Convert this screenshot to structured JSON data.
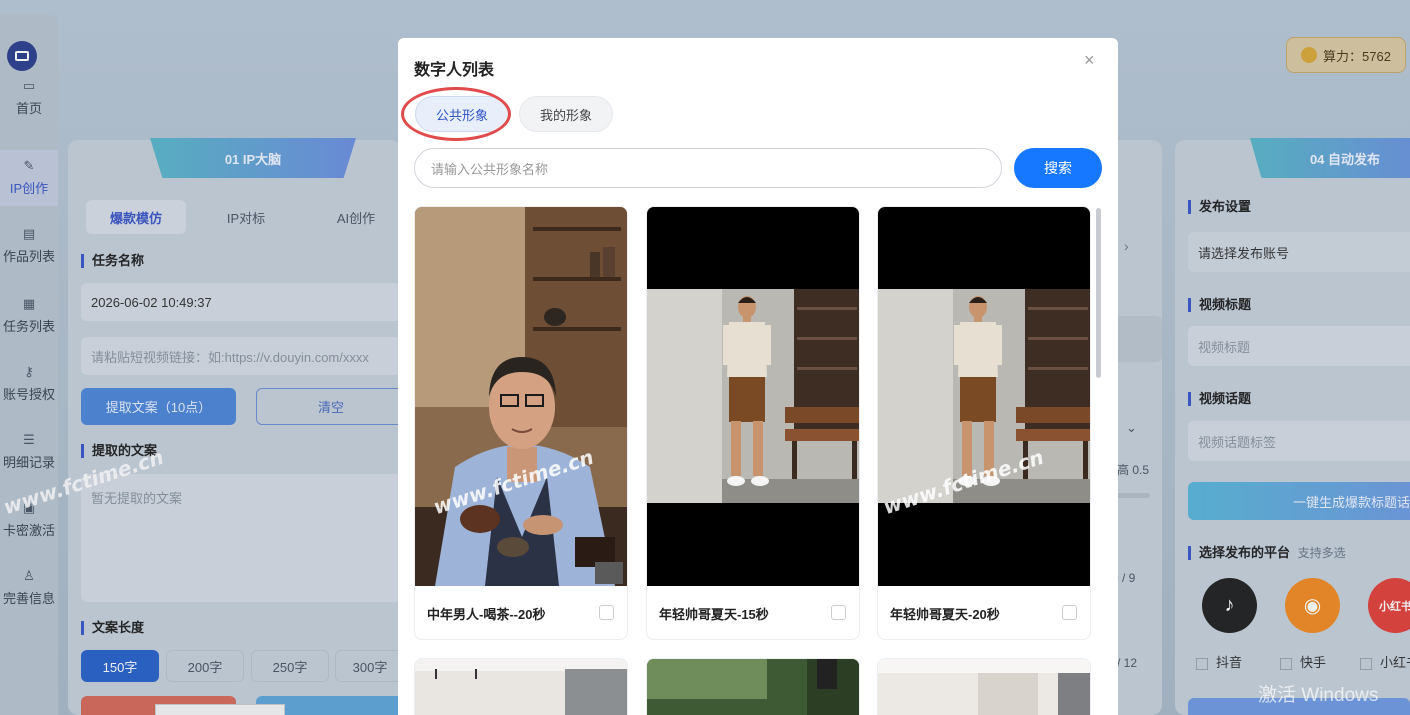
{
  "sidebar": {
    "items": [
      {
        "label": "首页",
        "icon": "monitor-icon"
      },
      {
        "label": "IP创作",
        "icon": "edit-icon"
      },
      {
        "label": "作品列表",
        "icon": "document-icon"
      },
      {
        "label": "任务列表",
        "icon": "clipboard-icon"
      },
      {
        "label": "账号授权",
        "icon": "key-icon"
      },
      {
        "label": "明细记录",
        "icon": "list-icon"
      },
      {
        "label": "卡密激活",
        "icon": "card-icon"
      },
      {
        "label": "完善信息",
        "icon": "user-icon"
      }
    ]
  },
  "credits": {
    "label": "算力：5762"
  },
  "left_panel": {
    "ribbon": "01 IP大脑",
    "tabs": [
      "爆款模仿",
      "IP对标",
      "AI创作"
    ],
    "task_name_title": "任务名称",
    "task_name_value": "2026-06-02 10:49:37",
    "video_link_placeholder": "请粘贴短视频链接：如:https://v.douyin.com/xxxx",
    "extract_button": "提取文案（10点）",
    "clear_button": "清空",
    "extracted_title": "提取的文案",
    "extracted_placeholder": "暂无提取的文案",
    "length_title": "文案长度",
    "lengths": [
      "150字",
      "200字",
      "250字",
      "300字"
    ]
  },
  "middle_partial": {
    "hint_right": "高 0.5",
    "count1": "0 / 9",
    "count2": "/ 12"
  },
  "right_panel": {
    "ribbon": "04 自动发布",
    "publish_title": "发布设置",
    "account_placeholder": "请选择发布账号",
    "video_title_label": "视频标题",
    "video_title_placeholder": "视频标题",
    "topic_label": "视频话题",
    "topic_placeholder": "视频话题标签",
    "gen_button": "一键生成爆款标题话",
    "platform_title": "选择发布的平台",
    "platform_hint": "支持多选",
    "platforms": [
      "抖音",
      "快手",
      "小红书"
    ]
  },
  "modal": {
    "title": "数字人列表",
    "close": "×",
    "tabs": [
      "公共形象",
      "我的形象"
    ],
    "search_placeholder": "请输入公共形象名称",
    "search_button": "搜索",
    "cards": [
      {
        "name": "中年男人-喝茶--20秒"
      },
      {
        "name": "年轻帅哥夏天-15秒"
      },
      {
        "name": "年轻帅哥夏天-20秒"
      }
    ]
  },
  "watermarks": [
    "www.fctime.cn",
    "www.fctime.cn",
    "www.fctime.cn"
  ],
  "windows_mark": "激活 Windows"
}
